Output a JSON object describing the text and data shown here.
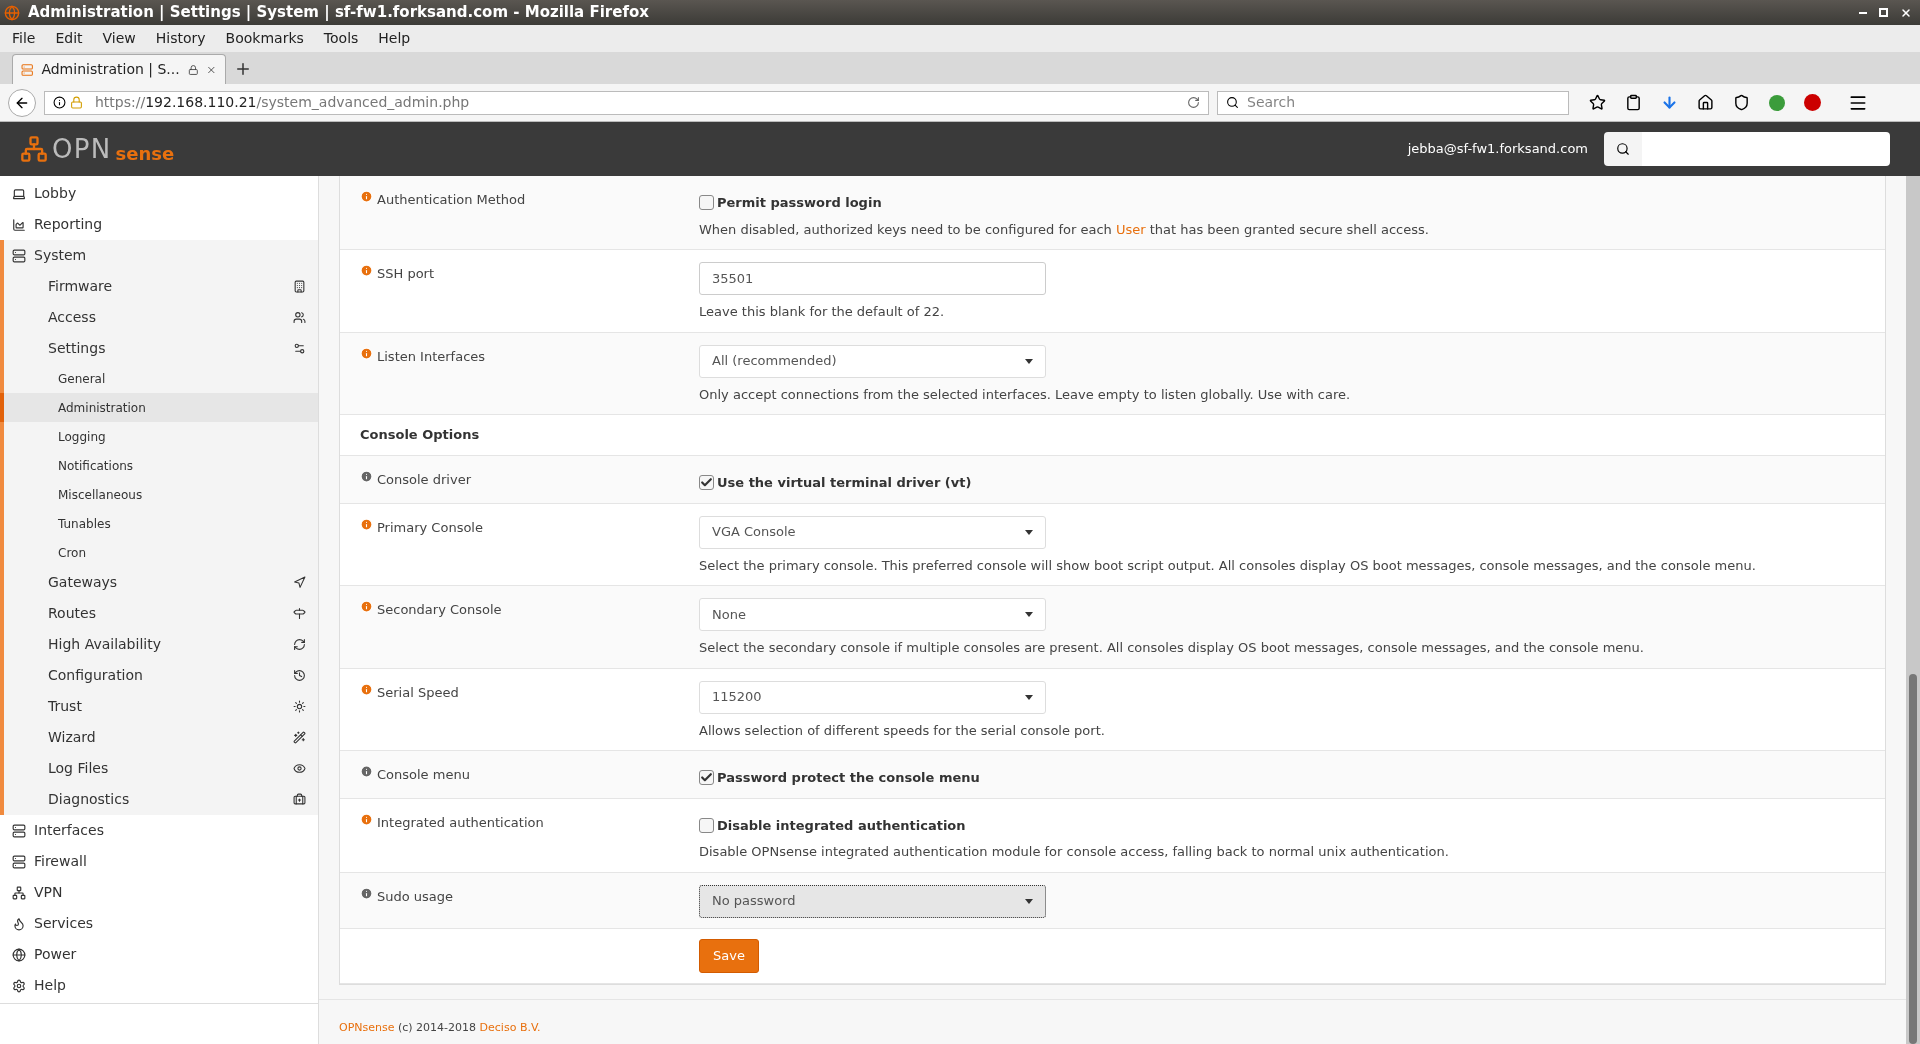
{
  "window": {
    "title": "Administration | Settings | System | sf-fw1.forksand.com - Mozilla Firefox"
  },
  "menu_bar": [
    "File",
    "Edit",
    "View",
    "History",
    "Bookmarks",
    "Tools",
    "Help"
  ],
  "tabs": [
    {
      "label": "Administration | S...",
      "selected": true
    }
  ],
  "address_bar": {
    "scheme": "https://",
    "host": "192.168.110.21",
    "path": "/system_advanced_admin.php"
  },
  "browser_search": {
    "placeholder": "Search"
  },
  "header": {
    "logo_left": "OPN",
    "logo_right": "sense",
    "user": "jebba@sf-fw1.forksand.com"
  },
  "sidebar": {
    "items": [
      {
        "label": "Lobby",
        "selected": false
      },
      {
        "label": "Reporting",
        "selected": false
      },
      {
        "label": "System",
        "selected": false,
        "expanded": true,
        "children": [
          {
            "label": "Firmware",
            "selected": false
          },
          {
            "label": "Access",
            "selected": false
          },
          {
            "label": "Settings",
            "selected": false,
            "expanded": true,
            "children": [
              {
                "label": "General",
                "selected": false
              },
              {
                "label": "Administration",
                "selected": true
              },
              {
                "label": "Logging",
                "selected": false
              },
              {
                "label": "Notifications",
                "selected": false
              },
              {
                "label": "Miscellaneous",
                "selected": false
              },
              {
                "label": "Tunables",
                "selected": false
              },
              {
                "label": "Cron",
                "selected": false
              }
            ]
          },
          {
            "label": "Gateways",
            "selected": false
          },
          {
            "label": "Routes",
            "selected": false
          },
          {
            "label": "High Availability",
            "selected": false
          },
          {
            "label": "Configuration",
            "selected": false
          },
          {
            "label": "Trust",
            "selected": false
          },
          {
            "label": "Wizard",
            "selected": false
          },
          {
            "label": "Log Files",
            "selected": false
          },
          {
            "label": "Diagnostics",
            "selected": false
          }
        ]
      },
      {
        "label": "Interfaces",
        "selected": false
      },
      {
        "label": "Firewall",
        "selected": false
      },
      {
        "label": "VPN",
        "selected": false
      },
      {
        "label": "Services",
        "selected": false
      },
      {
        "label": "Power",
        "selected": false
      },
      {
        "label": "Help",
        "selected": false
      }
    ]
  },
  "form": {
    "rows": [
      {
        "kind": "checkbox",
        "label": "Authentication Method",
        "has_help": true,
        "checked": false,
        "option": "Permit password login",
        "help": "When disabled, authorized keys need to be configured for each ",
        "help_link": "User",
        "help_after": " that has been granted secure shell access."
      },
      {
        "kind": "input",
        "label": "SSH port",
        "has_help": true,
        "value": "35501",
        "help": "Leave this blank for the default of 22."
      },
      {
        "kind": "select",
        "label": "Listen Interfaces",
        "has_help": true,
        "value": "All (recommended)",
        "focused": false,
        "help": "Only accept connections from the selected interfaces. Leave empty to listen globally. Use with care."
      },
      {
        "kind": "section",
        "label": "Console Options"
      },
      {
        "kind": "checkbox",
        "label": "Console driver",
        "has_help": false,
        "checked": true,
        "option": "Use the virtual terminal driver (vt)"
      },
      {
        "kind": "select",
        "label": "Primary Console",
        "has_help": true,
        "value": "VGA Console",
        "focused": false,
        "help": "Select the primary console. This preferred console will show boot script output. All consoles display OS boot messages, console messages, and the console menu."
      },
      {
        "kind": "select",
        "label": "Secondary Console",
        "has_help": true,
        "value": "None",
        "focused": false,
        "help": "Select the secondary console if multiple consoles are present. All consoles display OS boot messages, console messages, and the console menu."
      },
      {
        "kind": "select",
        "label": "Serial Speed",
        "has_help": true,
        "value": "115200",
        "focused": false,
        "help": "Allows selection of different speeds for the serial console port."
      },
      {
        "kind": "checkbox",
        "label": "Console menu",
        "has_help": false,
        "checked": true,
        "option": "Password protect the console menu"
      },
      {
        "kind": "checkbox",
        "label": "Integrated authentication",
        "has_help": true,
        "checked": false,
        "option": "Disable integrated authentication",
        "help": "Disable OPNsense integrated authentication module for console access, falling back to normal unix authentication."
      },
      {
        "kind": "select",
        "label": "Sudo usage",
        "has_help": false,
        "value": "No password",
        "focused": true
      },
      {
        "kind": "button",
        "label": "Save"
      }
    ]
  },
  "footer": {
    "brand": "OPNsense",
    "text": " (c) 2014-2018 ",
    "company": "Deciso B.V."
  }
}
